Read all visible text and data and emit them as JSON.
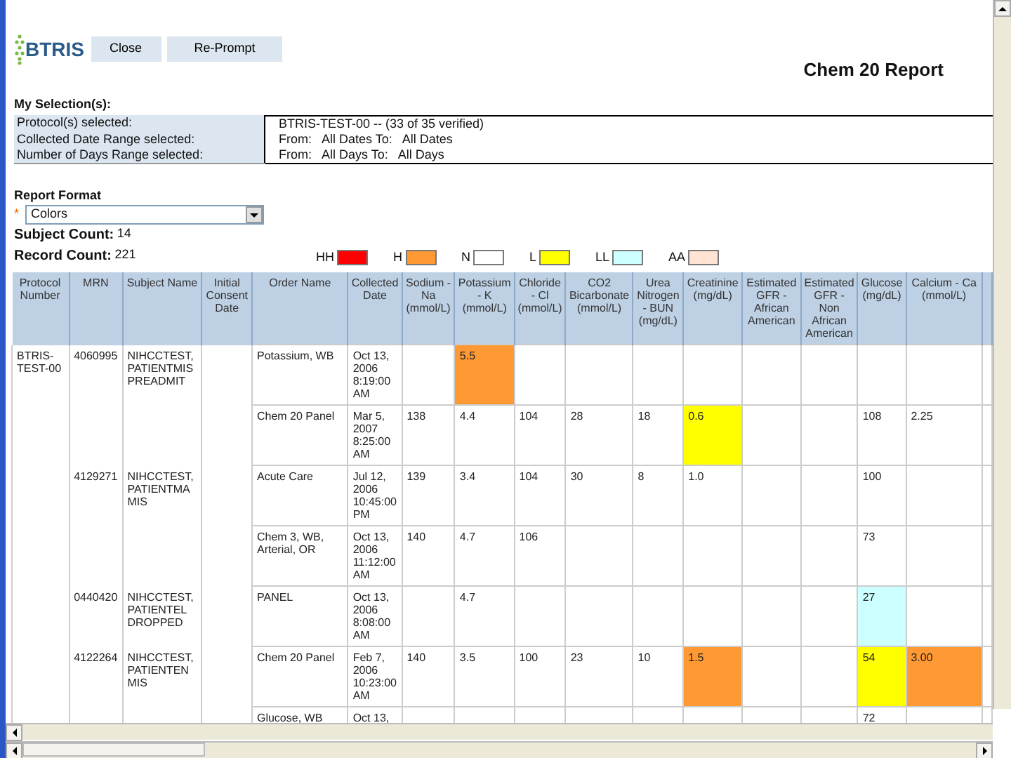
{
  "logo": {
    "text": "BTRIS"
  },
  "buttons": [
    "Close",
    "Re-Prompt"
  ],
  "title": "Chem 20 Report",
  "selection": {
    "heading": "My Selection(s):",
    "rows": [
      {
        "label": "Protocol(s) selected:",
        "value": "BTRIS-TEST-00 -- (33 of 35 verified)"
      },
      {
        "label": "Collected Date Range selected:",
        "value": "From:   All Dates To:   All Dates"
      },
      {
        "label": "Number of Days Range selected:",
        "value": "From:   All Days To:   All Days"
      }
    ]
  },
  "report_format": {
    "label": "Report Format",
    "required_mark": "*",
    "value": "Colors"
  },
  "counts": [
    {
      "label": "Subject Count:",
      "value": "14"
    },
    {
      "label": "Record Count:",
      "value": "221"
    }
  ],
  "legend": [
    {
      "label": "HH",
      "color": "#ff0000"
    },
    {
      "label": "H",
      "color": "#ff9933"
    },
    {
      "label": "N",
      "color": "#ffffff"
    },
    {
      "label": "L",
      "color": "#ffff00"
    },
    {
      "label": "LL",
      "color": "#ccffff"
    },
    {
      "label": "AA",
      "color": "#ffe4d4"
    }
  ],
  "report_table": {
    "columns": [
      "Protocol Number",
      "MRN",
      "Subject Name",
      "Initial Consent Date",
      "Order Name",
      "Collected Date",
      "Sodium - Na (mmol/L)",
      "Potassium - K (mmol/L)",
      "Chloride - Cl (mmol/L)",
      "CO2 Bicarbonate (mmol/L)",
      "Urea Nitrogen - BUN (mg/dL)",
      "Creatinine (mg/dL)",
      "Estimated GFR - African American",
      "Estimated GFR - Non African American",
      "Glucose (mg/dL)",
      "Calcium - Ca (mmol/L)"
    ],
    "protocols": [
      {
        "protocol_number": "BTRIS-TEST-00",
        "subjects": [
          {
            "mrn": "4060995",
            "subject_name": "NIHCCTEST, PATIENTMIS PREADMIT",
            "orders": [
              {
                "cells": [
                  {
                    "text": "Potassium, WB"
                  },
                  {
                    "text": "Oct 13, 2006 8:19:00 AM"
                  },
                  {},
                  {
                    "text": "5.5",
                    "color": "#ff9933"
                  },
                  {},
                  {},
                  {},
                  {},
                  {},
                  {},
                  {},
                  {}
                ]
              },
              {
                "cells": [
                  {
                    "text": "Chem 20 Panel"
                  },
                  {
                    "text": "Mar 5, 2007 8:25:00 AM"
                  },
                  {
                    "text": "138"
                  },
                  {
                    "text": "4.4"
                  },
                  {
                    "text": "104"
                  },
                  {
                    "text": "28"
                  },
                  {
                    "text": "18"
                  },
                  {
                    "text": "0.6",
                    "color": "#ffff00"
                  },
                  {},
                  {},
                  {
                    "text": "108"
                  },
                  {
                    "text": "2.25"
                  }
                ]
              }
            ]
          },
          {
            "mrn": "4129271",
            "subject_name": "NIHCCTEST, PATIENTMA MIS",
            "orders": [
              {
                "cells": [
                  {
                    "text": "Acute Care"
                  },
                  {
                    "text": "Jul 12, 2006 10:45:00 PM"
                  },
                  {
                    "text": "139"
                  },
                  {
                    "text": "3.4"
                  },
                  {
                    "text": "104"
                  },
                  {
                    "text": "30"
                  },
                  {
                    "text": "8"
                  },
                  {
                    "text": "1.0"
                  },
                  {},
                  {},
                  {
                    "text": "100"
                  },
                  {}
                ]
              },
              {
                "cells": [
                  {
                    "text": "Chem 3, WB, Arterial, OR"
                  },
                  {
                    "text": "Oct 13, 2006 11:12:00 AM"
                  },
                  {
                    "text": "140"
                  },
                  {
                    "text": "4.7"
                  },
                  {
                    "text": "106"
                  },
                  {},
                  {},
                  {},
                  {},
                  {},
                  {
                    "text": "73"
                  },
                  {}
                ]
              }
            ]
          },
          {
            "mrn": "0440420",
            "subject_name": "NIHCCTEST, PATIENTEL DROPPED",
            "orders": [
              {
                "cells": [
                  {
                    "text": "PANEL"
                  },
                  {
                    "text": "Oct 13, 2006 8:08:00 AM"
                  },
                  {},
                  {
                    "text": "4.7"
                  },
                  {},
                  {},
                  {},
                  {},
                  {},
                  {},
                  {
                    "text": "27",
                    "color": "#ccffff"
                  },
                  {}
                ]
              }
            ]
          },
          {
            "mrn": "4122264",
            "subject_name": "NIHCCTEST, PATIENTEN MIS",
            "orders": [
              {
                "cells": [
                  {
                    "text": "Chem 20 Panel"
                  },
                  {
                    "text": "Feb 7, 2006 10:23:00 AM"
                  },
                  {
                    "text": "140"
                  },
                  {
                    "text": "3.5"
                  },
                  {
                    "text": "100"
                  },
                  {
                    "text": "23"
                  },
                  {
                    "text": "10"
                  },
                  {
                    "text": "1.5",
                    "color": "#ff9933"
                  },
                  {},
                  {},
                  {
                    "text": "54",
                    "color": "#ffff00"
                  },
                  {
                    "text": "3.00",
                    "color": "#ff9933"
                  }
                ]
              },
              {
                "cells": [
                  {
                    "text": "Glucose, WB"
                  },
                  {
                    "text": "Oct 13,"
                  },
                  {},
                  {},
                  {},
                  {},
                  {},
                  {},
                  {},
                  {},
                  {
                    "text": "72"
                  },
                  {}
                ]
              }
            ]
          }
        ]
      }
    ]
  }
}
